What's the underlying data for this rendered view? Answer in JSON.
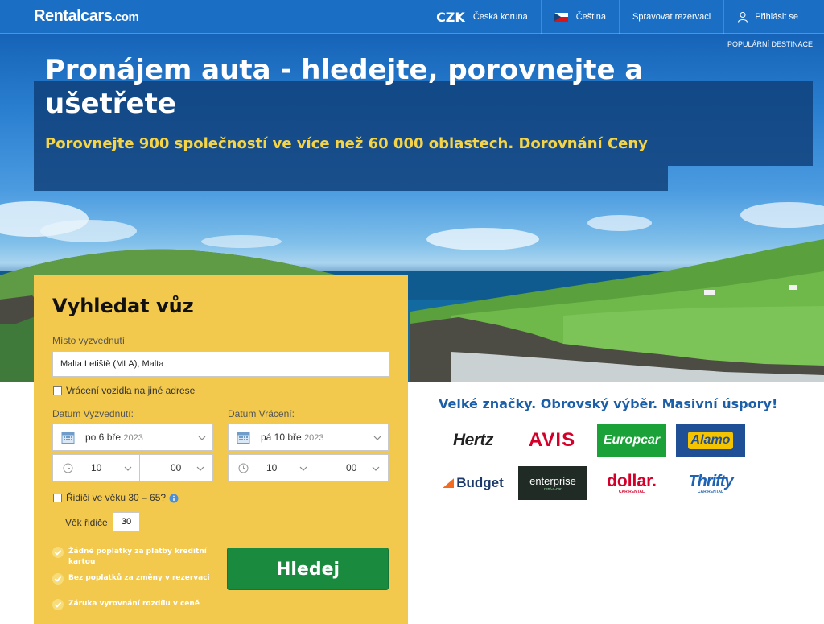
{
  "header": {
    "logo": "Rentalcars",
    "logo_suffix": ".com",
    "currency_code": "CZK",
    "currency_name": "Česká koruna",
    "language": "Čeština",
    "manage_booking": "Spravovat rezervaci",
    "sign_in": "Přihlásit se"
  },
  "hero": {
    "popular_destinations": "POPULÁRNÍ DESTINACE",
    "headline": "Pronájem auta - hledejte, porovnejte a ušetřete",
    "subline": "Porovnejte 900 společností ve více než 60 000 oblastech. Dorovnání Ceny"
  },
  "search": {
    "title": "Vyhledat vůz",
    "pickup_location_label": "Místo vyzvednutí",
    "pickup_location_value": "Malta Letiště (MLA), Malta",
    "return_other_label": "Vrácení vozidla na jiné adrese",
    "pickup_date_label": "Datum Vyzvednutí:",
    "pickup_date_value": "po 6 bře",
    "pickup_year": "2023",
    "pickup_hour": "10",
    "pickup_minute": "00",
    "return_date_label": "Datum Vrácení:",
    "return_date_value": "pá 10 bře",
    "return_year": "2023",
    "return_hour": "10",
    "return_minute": "00",
    "driver_age_check_label": "Řidiči ve věku 30 – 65?",
    "driver_age_label": "Věk řidiče",
    "driver_age_value": "30",
    "benefits": [
      "Žádné poplatky za platby kreditní kartou",
      "Bez poplatků za změny v rezervaci",
      "Záruka vyrovnání rozdílu v ceně"
    ],
    "search_button": "Hledej"
  },
  "brands": {
    "title": "Velké značky. Obrovský výběr. Masivní úspory!",
    "items": [
      "Hertz",
      "AVIS",
      "Europcar",
      "Alamo",
      "Budget",
      "enterprise",
      "dollar.",
      "Thrifty"
    ],
    "subtexts": [
      "CAR RENTAL",
      "CAR RENTAL",
      "rent-a-car"
    ]
  },
  "colors": {
    "header_blue": "#1a6fc4",
    "panel_yellow": "#f2c94c",
    "search_green": "#1a8a3e",
    "subline_yellow": "#f5d547"
  }
}
